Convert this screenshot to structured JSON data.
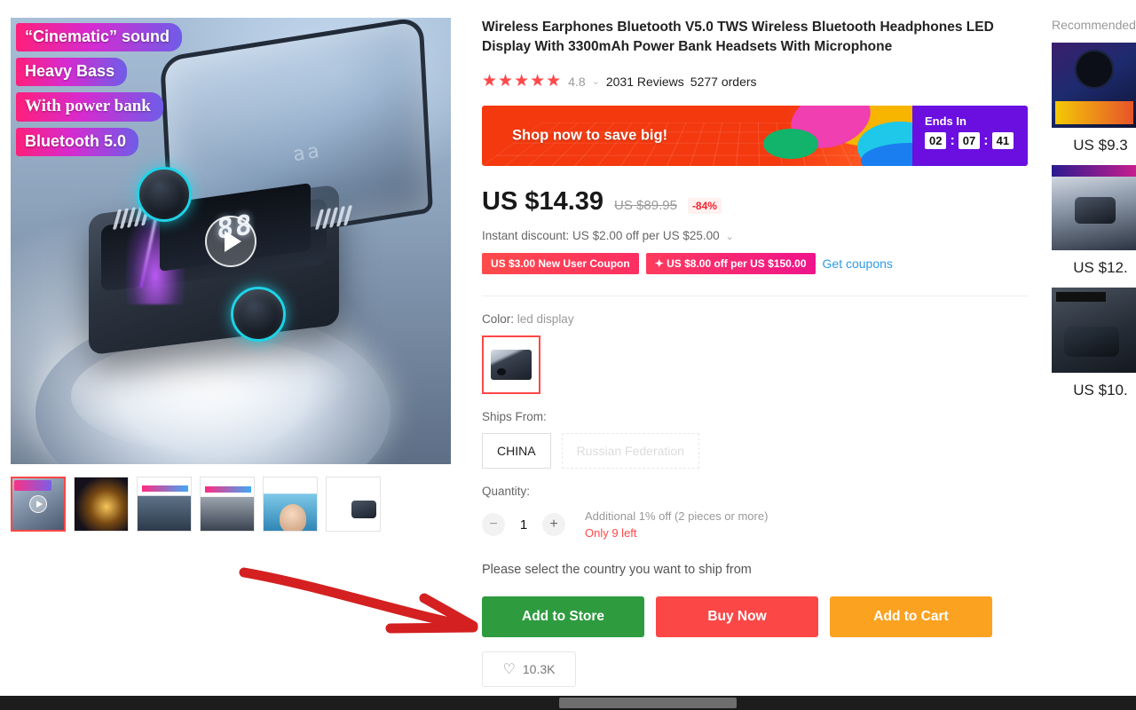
{
  "product": {
    "title": "Wireless Earphones Bluetooth V5.0 TWS Wireless Bluetooth Headphones LED Display With 3300mAh Power Bank Headsets With Microphone",
    "stars": "★★★★★",
    "score": "4.8",
    "reviews": "2031 Reviews",
    "orders": "5277 orders",
    "image_badges": [
      "“Cinematic” sound",
      "Heavy Bass",
      "With power bank",
      "Bluetooth 5.0"
    ],
    "display_text": "88",
    "lid_label": "aa"
  },
  "promo": {
    "text": "Shop now to save big!",
    "ends_label": "Ends In",
    "hours": "02",
    "minutes": "07",
    "seconds": "41",
    "separator": ":"
  },
  "price": {
    "current": "US $14.39",
    "original": "US $89.95",
    "discount": "-84%",
    "instant_discount": "Instant discount: US $2.00 off per US $25.00",
    "coupon_1": "US $3.00 New User Coupon",
    "coupon_2": "✦ US $8.00 off per US $150.00",
    "get_coupons": "Get coupons"
  },
  "options": {
    "color_label": "Color:",
    "color_value": "led display",
    "ships_label": "Ships From:",
    "ships_options": [
      {
        "label": "CHINA",
        "disabled": false
      },
      {
        "label": "Russian Federation",
        "disabled": true
      }
    ],
    "quantity_label": "Quantity:",
    "quantity_value": "1",
    "minus": "−",
    "plus": "+",
    "bulk_note": "Additional 1% off (2 pieces or more)",
    "stock_note": "Only 9 left"
  },
  "actions": {
    "notice": "Please select the country you want to ship from",
    "add_to_store": "Add to Store",
    "buy_now": "Buy Now",
    "add_to_cart": "Add to Cart",
    "wishlist_count": "10.3K",
    "heart_icon": "♡"
  },
  "sidebar": {
    "title": "Recommended",
    "items": [
      {
        "price": "US $9.3"
      },
      {
        "price": "US $12."
      },
      {
        "price": "US $10."
      }
    ]
  },
  "colors": {
    "accent_red": "#ff4747",
    "store_green": "#2e9b3f",
    "buy_red": "#fc4747",
    "cart_orange": "#fba221",
    "promo_orange": "#f4390f",
    "countdown_purple": "#6a0fe0",
    "link_blue": "#2e9ae6",
    "annotation_red": "#d42020"
  }
}
